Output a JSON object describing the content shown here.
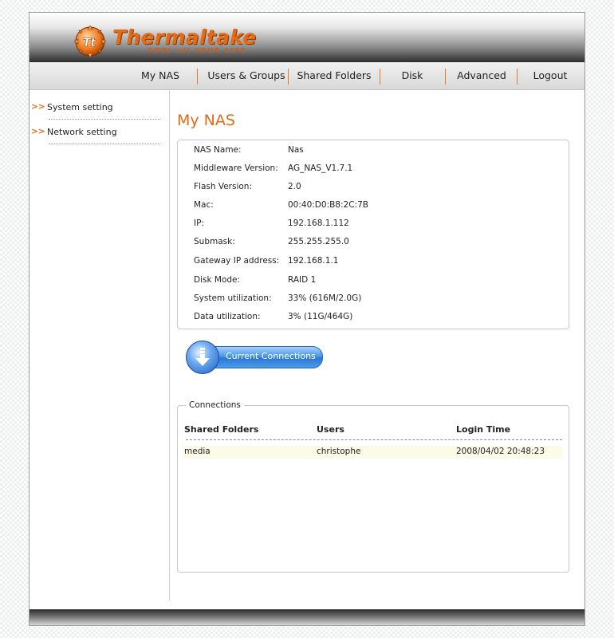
{
  "brand": {
    "name": "Thermaltake",
    "tagline": "COOL all YOUR LIFE",
    "badge": "Tt",
    "colors": {
      "accent": "#e56a16",
      "button": "#2c77d6"
    }
  },
  "nav": {
    "items": [
      {
        "label": "My NAS"
      },
      {
        "label": "Users & Groups"
      },
      {
        "label": "Shared Folders"
      },
      {
        "label": "Disk"
      },
      {
        "label": "Advanced"
      },
      {
        "label": "Logout"
      }
    ]
  },
  "sidebar": {
    "arrow": ">>",
    "items": [
      {
        "label": "System setting"
      },
      {
        "label": "Network setting"
      }
    ]
  },
  "page": {
    "title": "My NAS"
  },
  "info": {
    "rows": [
      {
        "label": "NAS Name:",
        "value": "Nas"
      },
      {
        "label": "Middleware Version:",
        "value": "AG_NAS_V1.7.1"
      },
      {
        "label": "Flash Version:",
        "value": "2.0"
      },
      {
        "label": "Mac:",
        "value": "00:40:D0:B8:2C:7B"
      },
      {
        "label": "IP:",
        "value": "192.168.1.112"
      },
      {
        "label": "Submask:",
        "value": "255.255.255.0"
      },
      {
        "label": "Gateway IP address:",
        "value": "192.168.1.1"
      },
      {
        "label": "Disk Mode:",
        "value": "RAID 1"
      },
      {
        "label": "System utilization:",
        "value": "33% (616M/2.0G)"
      },
      {
        "label": "Data utilization:",
        "value": "3% (11G/464G)"
      }
    ]
  },
  "connections_button": {
    "label": "Current Connections",
    "icon": "download-arrow-icon"
  },
  "connections": {
    "legend": "Connections",
    "headers": {
      "folders": "Shared Folders",
      "users": "Users",
      "login_time": "Login Time"
    },
    "rows": [
      {
        "folder": "media",
        "user": "christophe",
        "login_time": "2008/04/02 20:48:23"
      }
    ]
  }
}
